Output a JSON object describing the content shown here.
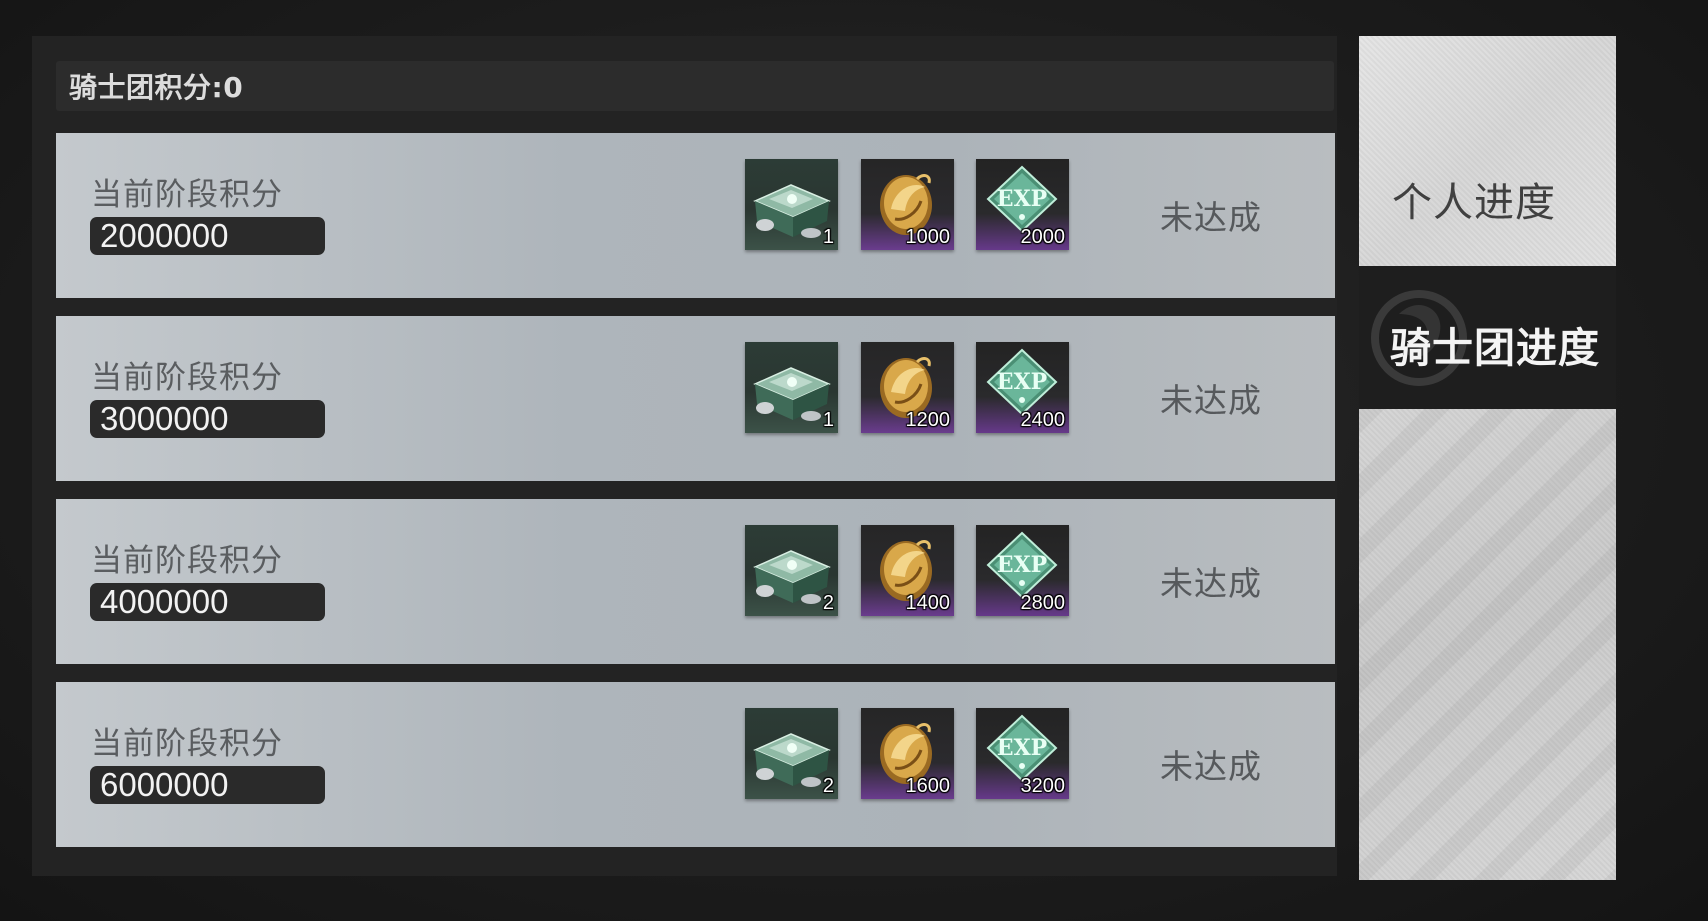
{
  "header": {
    "score_text": "骑士团积分:0"
  },
  "tabs": [
    {
      "label": "个人进度",
      "selected": false
    },
    {
      "label": "骑士团进度",
      "selected": true
    }
  ],
  "stages": [
    {
      "label": "当前阶段积分",
      "value": "2000000",
      "rewards": {
        "chest": "1",
        "coin": "1000",
        "exp": "2000"
      },
      "status": "未达成"
    },
    {
      "label": "当前阶段积分",
      "value": "3000000",
      "rewards": {
        "chest": "1",
        "coin": "1200",
        "exp": "2400"
      },
      "status": "未达成"
    },
    {
      "label": "当前阶段积分",
      "value": "4000000",
      "rewards": {
        "chest": "2",
        "coin": "1400",
        "exp": "2800"
      },
      "status": "未达成"
    },
    {
      "label": "当前阶段积分",
      "value": "6000000",
      "rewards": {
        "chest": "2",
        "coin": "1600",
        "exp": "3200"
      },
      "status": "未达成"
    }
  ],
  "reward_icons": {
    "chest": "treasure-chest-icon",
    "coin": "gold-coin-icon",
    "exp": "exp-crystal-icon"
  },
  "colors": {
    "row_background": "#b3b9be",
    "value_badge": "#2a2a2a",
    "selected_tab": "#1e1e1e",
    "rare_purple": "#6a3c8e"
  }
}
